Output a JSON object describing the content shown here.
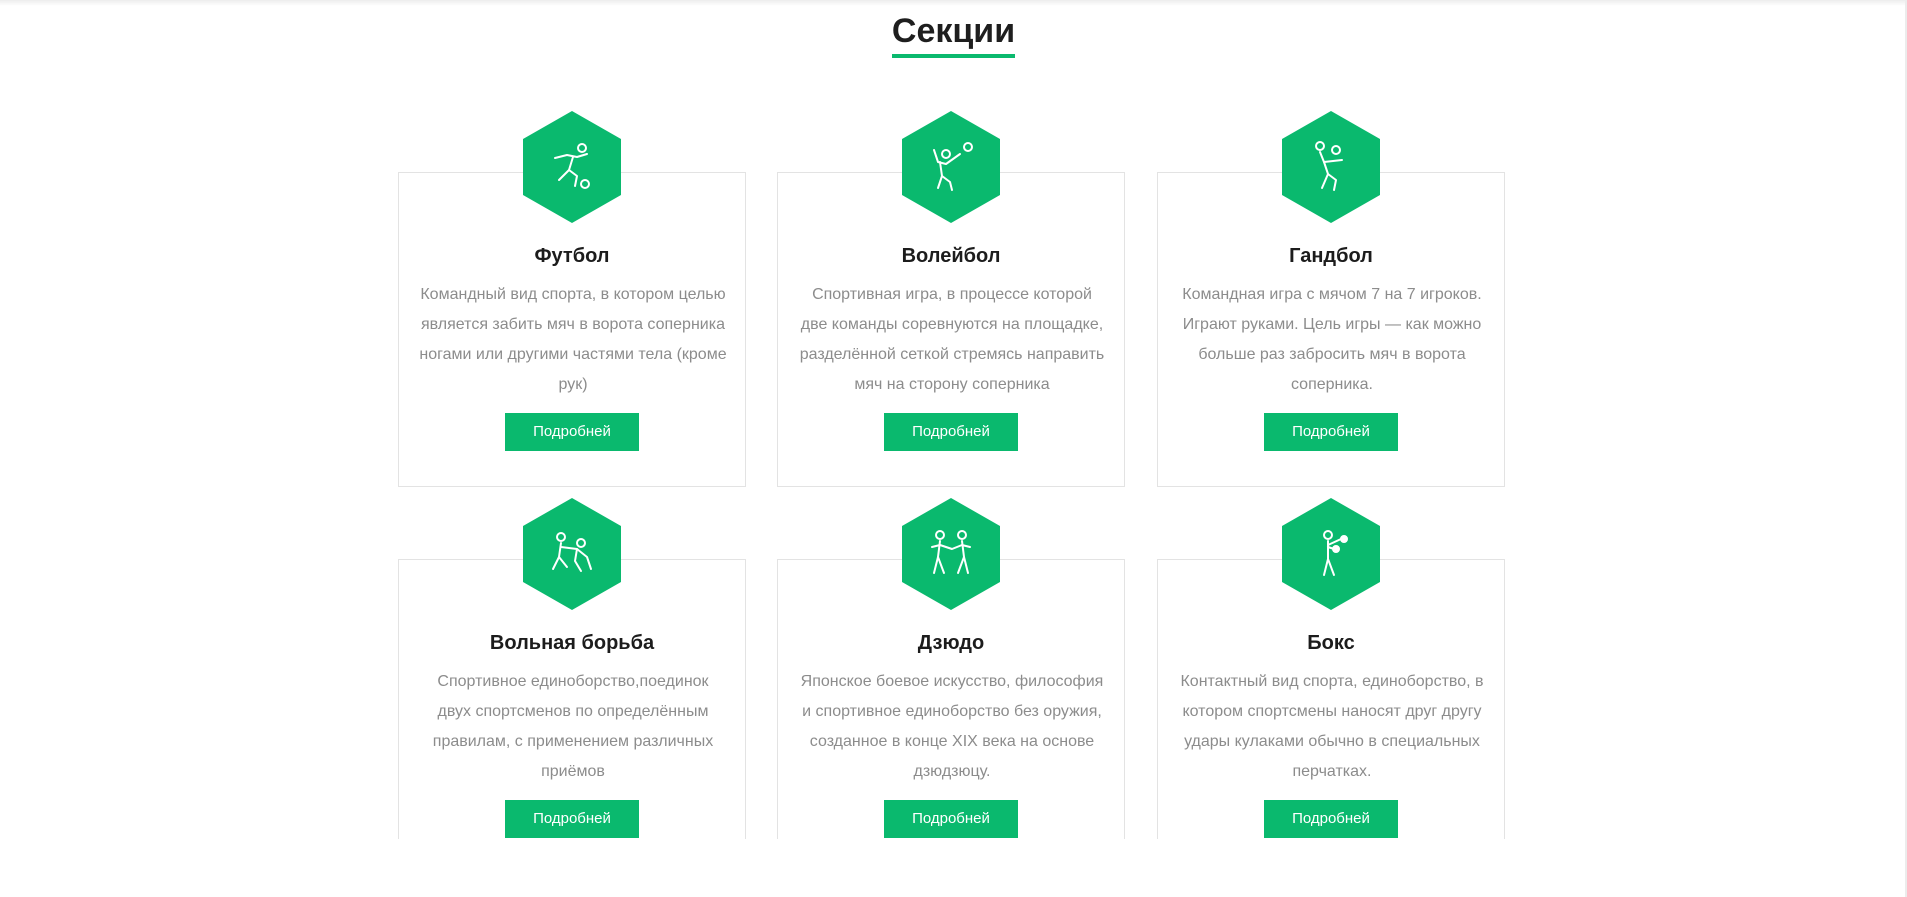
{
  "page": {
    "title": "Секции",
    "accent_color": "#0ab96e"
  },
  "cards": [
    {
      "title": "Футбол",
      "text": "Командный вид спорта, в котором целью является забить мяч в ворота соперника ногами или другими частями тела (кроме рук)",
      "button": "Подробней",
      "icon": "football-player-icon"
    },
    {
      "title": "Волейбол",
      "text": "Спортивная игра, в процессе которой две команды соревнуются на площадке, разделённой сеткой стремясь направить мяч на сторону соперника",
      "button": "Подробней",
      "icon": "volleyball-player-icon"
    },
    {
      "title": "Гандбол",
      "text": "Командная игра с мячом 7 на 7 игроков. Играют руками. Цель игры — как можно больше раз забросить мяч в ворота соперника.",
      "button": "Подробней",
      "icon": "handball-player-icon"
    },
    {
      "title": "Вольная борьба",
      "text": "Спортивное единоборство,поединок двух спортсменов по определённым правилам, с применением различных приёмов",
      "button": "Подробней",
      "icon": "wrestlers-icon"
    },
    {
      "title": "Дзюдо",
      "text": "Японское боевое искусство, философия и спортивное единоборство без оружия, созданное в конце XIX века на основе дзюдзюцу.",
      "button": "Подробней",
      "icon": "judo-fighters-icon"
    },
    {
      "title": "Бокс",
      "text": "Контактный вид спорта, единоборство, в котором спортсмены наносят друг другу удары кулаками обычно в специальных перчатках.",
      "button": "Подробней",
      "icon": "boxer-icon"
    }
  ]
}
